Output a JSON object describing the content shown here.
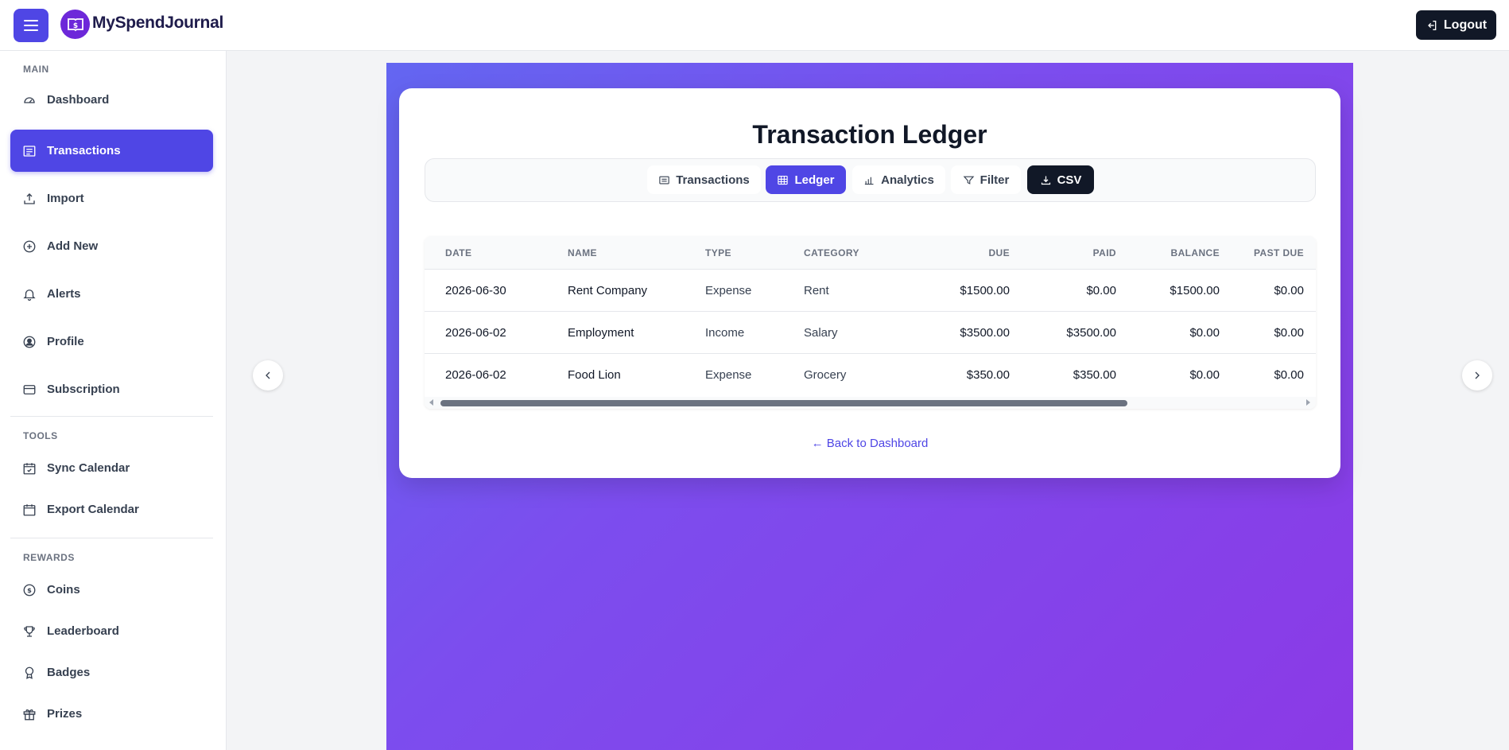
{
  "header": {
    "brand": "MySpendJournal",
    "logout_label": "Logout"
  },
  "sidebar": {
    "sections": {
      "main": "MAIN",
      "tools": "TOOLS",
      "rewards": "REWARDS"
    },
    "items": [
      {
        "label": "Dashboard",
        "icon": "gauge-icon"
      },
      {
        "label": "Transactions",
        "icon": "list-icon",
        "active": true
      },
      {
        "label": "Import",
        "icon": "upload-icon"
      },
      {
        "label": "Add New",
        "icon": "plus-circle-icon"
      },
      {
        "label": "Alerts",
        "icon": "bell-icon"
      },
      {
        "label": "Profile",
        "icon": "user-circle-icon"
      },
      {
        "label": "Subscription",
        "icon": "credit-card-icon"
      },
      {
        "label": "Sync Calendar",
        "icon": "calendar-check-icon"
      },
      {
        "label": "Export Calendar",
        "icon": "calendar-icon"
      },
      {
        "label": "Coins",
        "icon": "coin-icon"
      },
      {
        "label": "Leaderboard",
        "icon": "trophy-icon"
      },
      {
        "label": "Badges",
        "icon": "award-icon"
      },
      {
        "label": "Prizes",
        "icon": "gift-icon"
      }
    ]
  },
  "main": {
    "title": "Transaction Ledger",
    "tabs": [
      {
        "label": "Transactions",
        "icon": "list-icon"
      },
      {
        "label": "Ledger",
        "icon": "table-icon",
        "active": true
      },
      {
        "label": "Analytics",
        "icon": "bar-chart-icon"
      },
      {
        "label": "Filter",
        "icon": "filter-icon"
      },
      {
        "label": "CSV",
        "icon": "download-icon"
      }
    ],
    "table": {
      "columns": [
        "DATE",
        "NAME",
        "TYPE",
        "CATEGORY",
        "DUE",
        "PAID",
        "BALANCE",
        "PAST DUE"
      ],
      "rows": [
        [
          "2026-06-30",
          "Rent Company",
          "Expense",
          "Rent",
          "$1500.00",
          "$0.00",
          "$1500.00",
          "$0.00"
        ],
        [
          "2026-06-02",
          "Employment",
          "Income",
          "Salary",
          "$3500.00",
          "$3500.00",
          "$0.00",
          "$0.00"
        ],
        [
          "2026-06-02",
          "Food Lion",
          "Expense",
          "Grocery",
          "$350.00",
          "$350.00",
          "$0.00",
          "$0.00"
        ]
      ]
    },
    "back_link": "← Back to Dashboard"
  },
  "colors": {
    "accent": "#4f46e5",
    "dark": "#111827",
    "gradient_start": "#6366f1",
    "gradient_end": "#8b3ae6"
  }
}
